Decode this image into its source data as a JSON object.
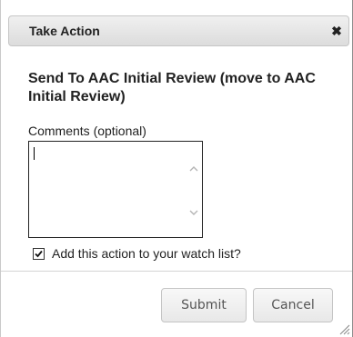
{
  "dialog": {
    "title": "Take Action",
    "close_icon": "close-icon",
    "close_glyph": "✖",
    "heading": "Send To AAC Initial Review (move to AAC Initial Review)",
    "comments": {
      "label": "Comments (optional)",
      "value": "",
      "placeholder": ""
    },
    "watch_list": {
      "label": "Add this action to your watch list?",
      "checked": true
    },
    "buttons": {
      "submit_label": "Submit",
      "cancel_label": "Cancel"
    },
    "colors": {
      "titlebar_top": "#f0f0f0",
      "titlebar_bottom": "#dcdcdc",
      "text": "#222222",
      "button_text": "#555555"
    }
  }
}
